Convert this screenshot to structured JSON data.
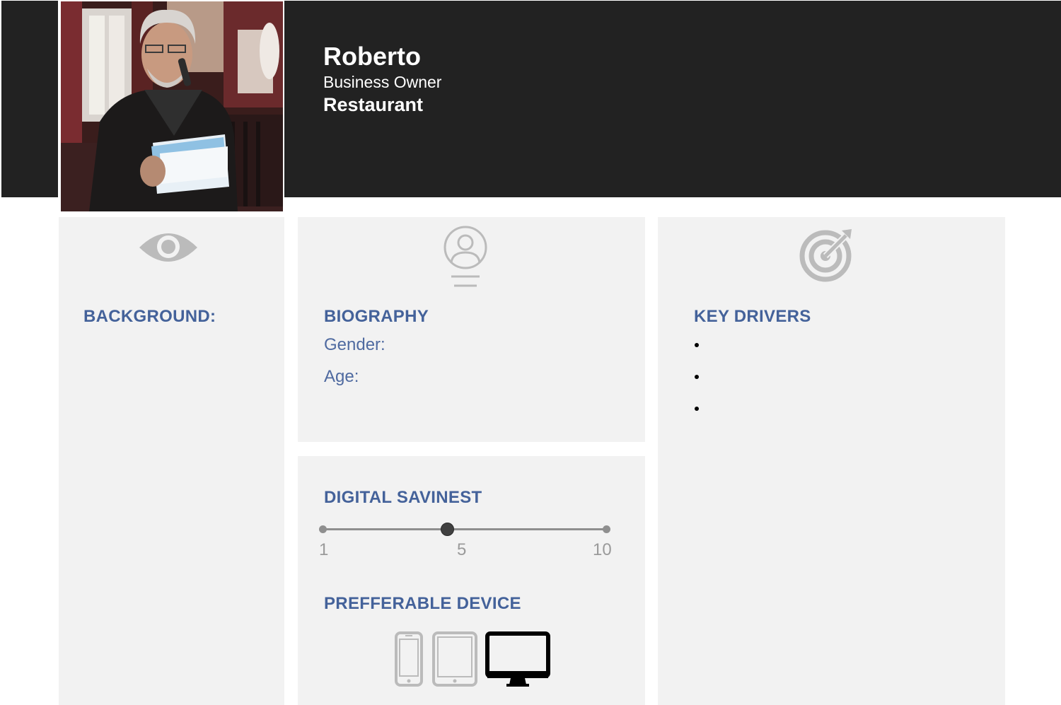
{
  "profile": {
    "name": "Roberto",
    "role": "Business Owner",
    "business": "Restaurant"
  },
  "background": {
    "icon": "eye-icon",
    "title": "BACKGROUND:"
  },
  "biography": {
    "icon": "user-profile-icon",
    "title": "BIOGRAPHY",
    "gender_label": "Gender:",
    "age_label": "Age:"
  },
  "key_drivers": {
    "icon": "target-icon",
    "title": "KEY DRIVERS",
    "items": [
      "",
      "",
      ""
    ]
  },
  "digital_savviness": {
    "title": "DIGITAL SAVINEST",
    "scale_labels": [
      "1",
      "5",
      "10"
    ],
    "value": 5,
    "min": 1,
    "max": 10
  },
  "preferred_device": {
    "title": "PREFFERABLE DEVICE",
    "devices": [
      {
        "icon": "smartphone-icon",
        "selected": false
      },
      {
        "icon": "tablet-icon",
        "selected": false
      },
      {
        "icon": "desktop-monitor-icon",
        "selected": true
      }
    ]
  },
  "colors": {
    "header_bg": "#222222",
    "panel_bg": "#f2f2f2",
    "heading": "#44629a",
    "icon_gray": "#bbbbbb",
    "selected_device": "#000000"
  }
}
